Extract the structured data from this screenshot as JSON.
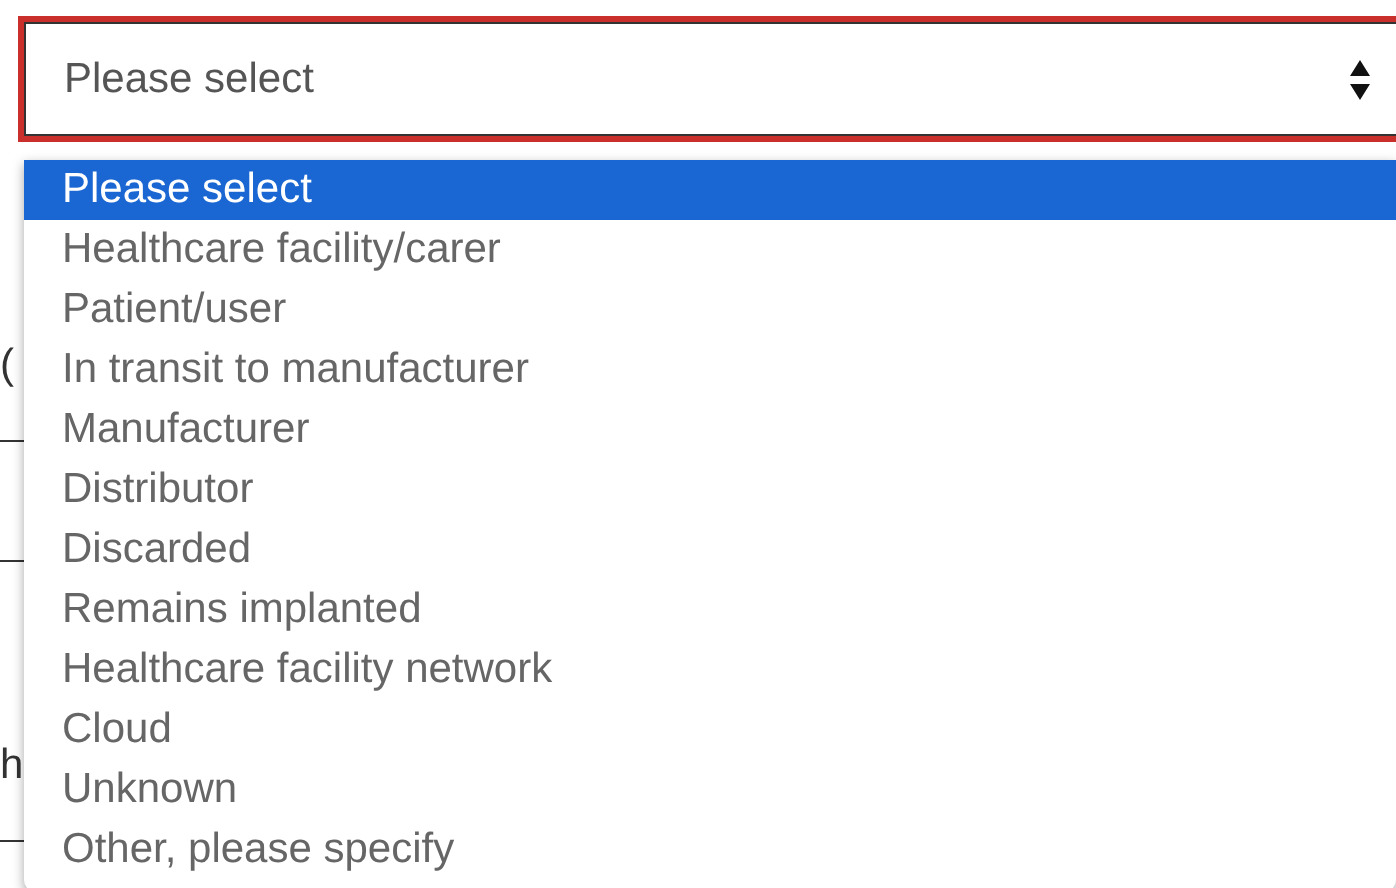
{
  "select": {
    "value": "Please select",
    "invalid": true
  },
  "background_texts": [
    "(",
    "h"
  ],
  "options": [
    {
      "label": "Please select",
      "selected": true
    },
    {
      "label": "Healthcare facility/carer",
      "selected": false
    },
    {
      "label": "Patient/user",
      "selected": false
    },
    {
      "label": "In transit to manufacturer",
      "selected": false
    },
    {
      "label": "Manufacturer",
      "selected": false
    },
    {
      "label": "Distributor",
      "selected": false
    },
    {
      "label": "Discarded",
      "selected": false
    },
    {
      "label": "Remains implanted",
      "selected": false
    },
    {
      "label": "Healthcare facility network",
      "selected": false
    },
    {
      "label": "Cloud",
      "selected": false
    },
    {
      "label": "Unknown",
      "selected": false
    },
    {
      "label": "Other, please specify",
      "selected": false
    }
  ]
}
